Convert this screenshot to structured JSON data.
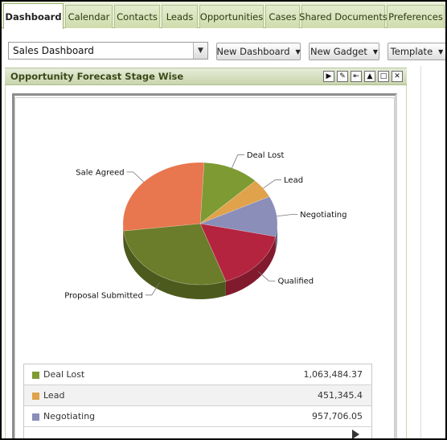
{
  "tabs": [
    {
      "label": "Dashboard",
      "active": true
    },
    {
      "label": "Calendar"
    },
    {
      "label": "Contacts"
    },
    {
      "label": "Leads"
    },
    {
      "label": "Opportunities"
    },
    {
      "label": "Cases"
    },
    {
      "label": "Shared Documents"
    },
    {
      "label": "Preferences"
    }
  ],
  "toolbar": {
    "dashboard_select": "Sales Dashboard",
    "new_dashboard": "New Dashboard",
    "new_gadget": "New Gadget",
    "template": "Template"
  },
  "gadget": {
    "title": "Opportunity Forecast Stage Wise",
    "icons": [
      "play-icon",
      "edit-icon",
      "pin-icon",
      "collapse-icon",
      "maximize-icon",
      "close-icon"
    ]
  },
  "chart_data": {
    "type": "pie",
    "slices": [
      {
        "label": "Deal Lost",
        "value": 1063484.37,
        "color": "#7e9a33"
      },
      {
        "label": "Lead",
        "value": 451345.4,
        "color": "#e0a24a"
      },
      {
        "label": "Negotiating",
        "value": 957706.05,
        "color": "#8a8eb9"
      },
      {
        "label": "Qualified",
        "value": 1450000,
        "color": "#b4243f"
      },
      {
        "label": "Proposal Submitted",
        "value": 2550000,
        "color": "#6b7d2a"
      },
      {
        "label": "Sale Agreed",
        "value": 2480000,
        "color": "#e8764e"
      }
    ]
  },
  "legend": [
    {
      "label": "Deal Lost",
      "value": "1,063,484.37",
      "color": "#7e9a33"
    },
    {
      "label": "Lead",
      "value": "451,345.4",
      "color": "#e0a24a"
    },
    {
      "label": "Negotiating",
      "value": "957,706.05",
      "color": "#8a8eb9"
    }
  ]
}
